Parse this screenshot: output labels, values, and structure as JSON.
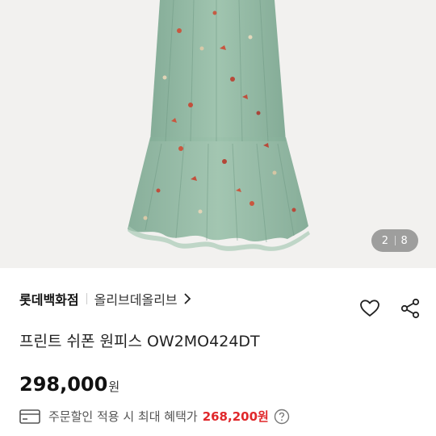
{
  "gallery": {
    "image_description_icon": "sage-green-floral-chiffon-dress-photo",
    "current_index": "2",
    "total_count": "8"
  },
  "product": {
    "brand": "롯데백화점",
    "store": "올리브데올리브",
    "title": "프린트 쉬폰 원피스 OW2MO424DT",
    "price": "298,000",
    "price_unit": "원",
    "benefit_text": "주문할인 적용 시 최대 혜택가",
    "benefit_price": "268,200원"
  },
  "icons": {
    "brand_arrow": "chevron-right-icon",
    "wishlist": "heart-icon",
    "share": "share-icon",
    "card": "credit-card-icon",
    "help": "question-circle-icon"
  },
  "colors": {
    "dress": "#8fb59f",
    "benefit_price": "#e0282b"
  }
}
